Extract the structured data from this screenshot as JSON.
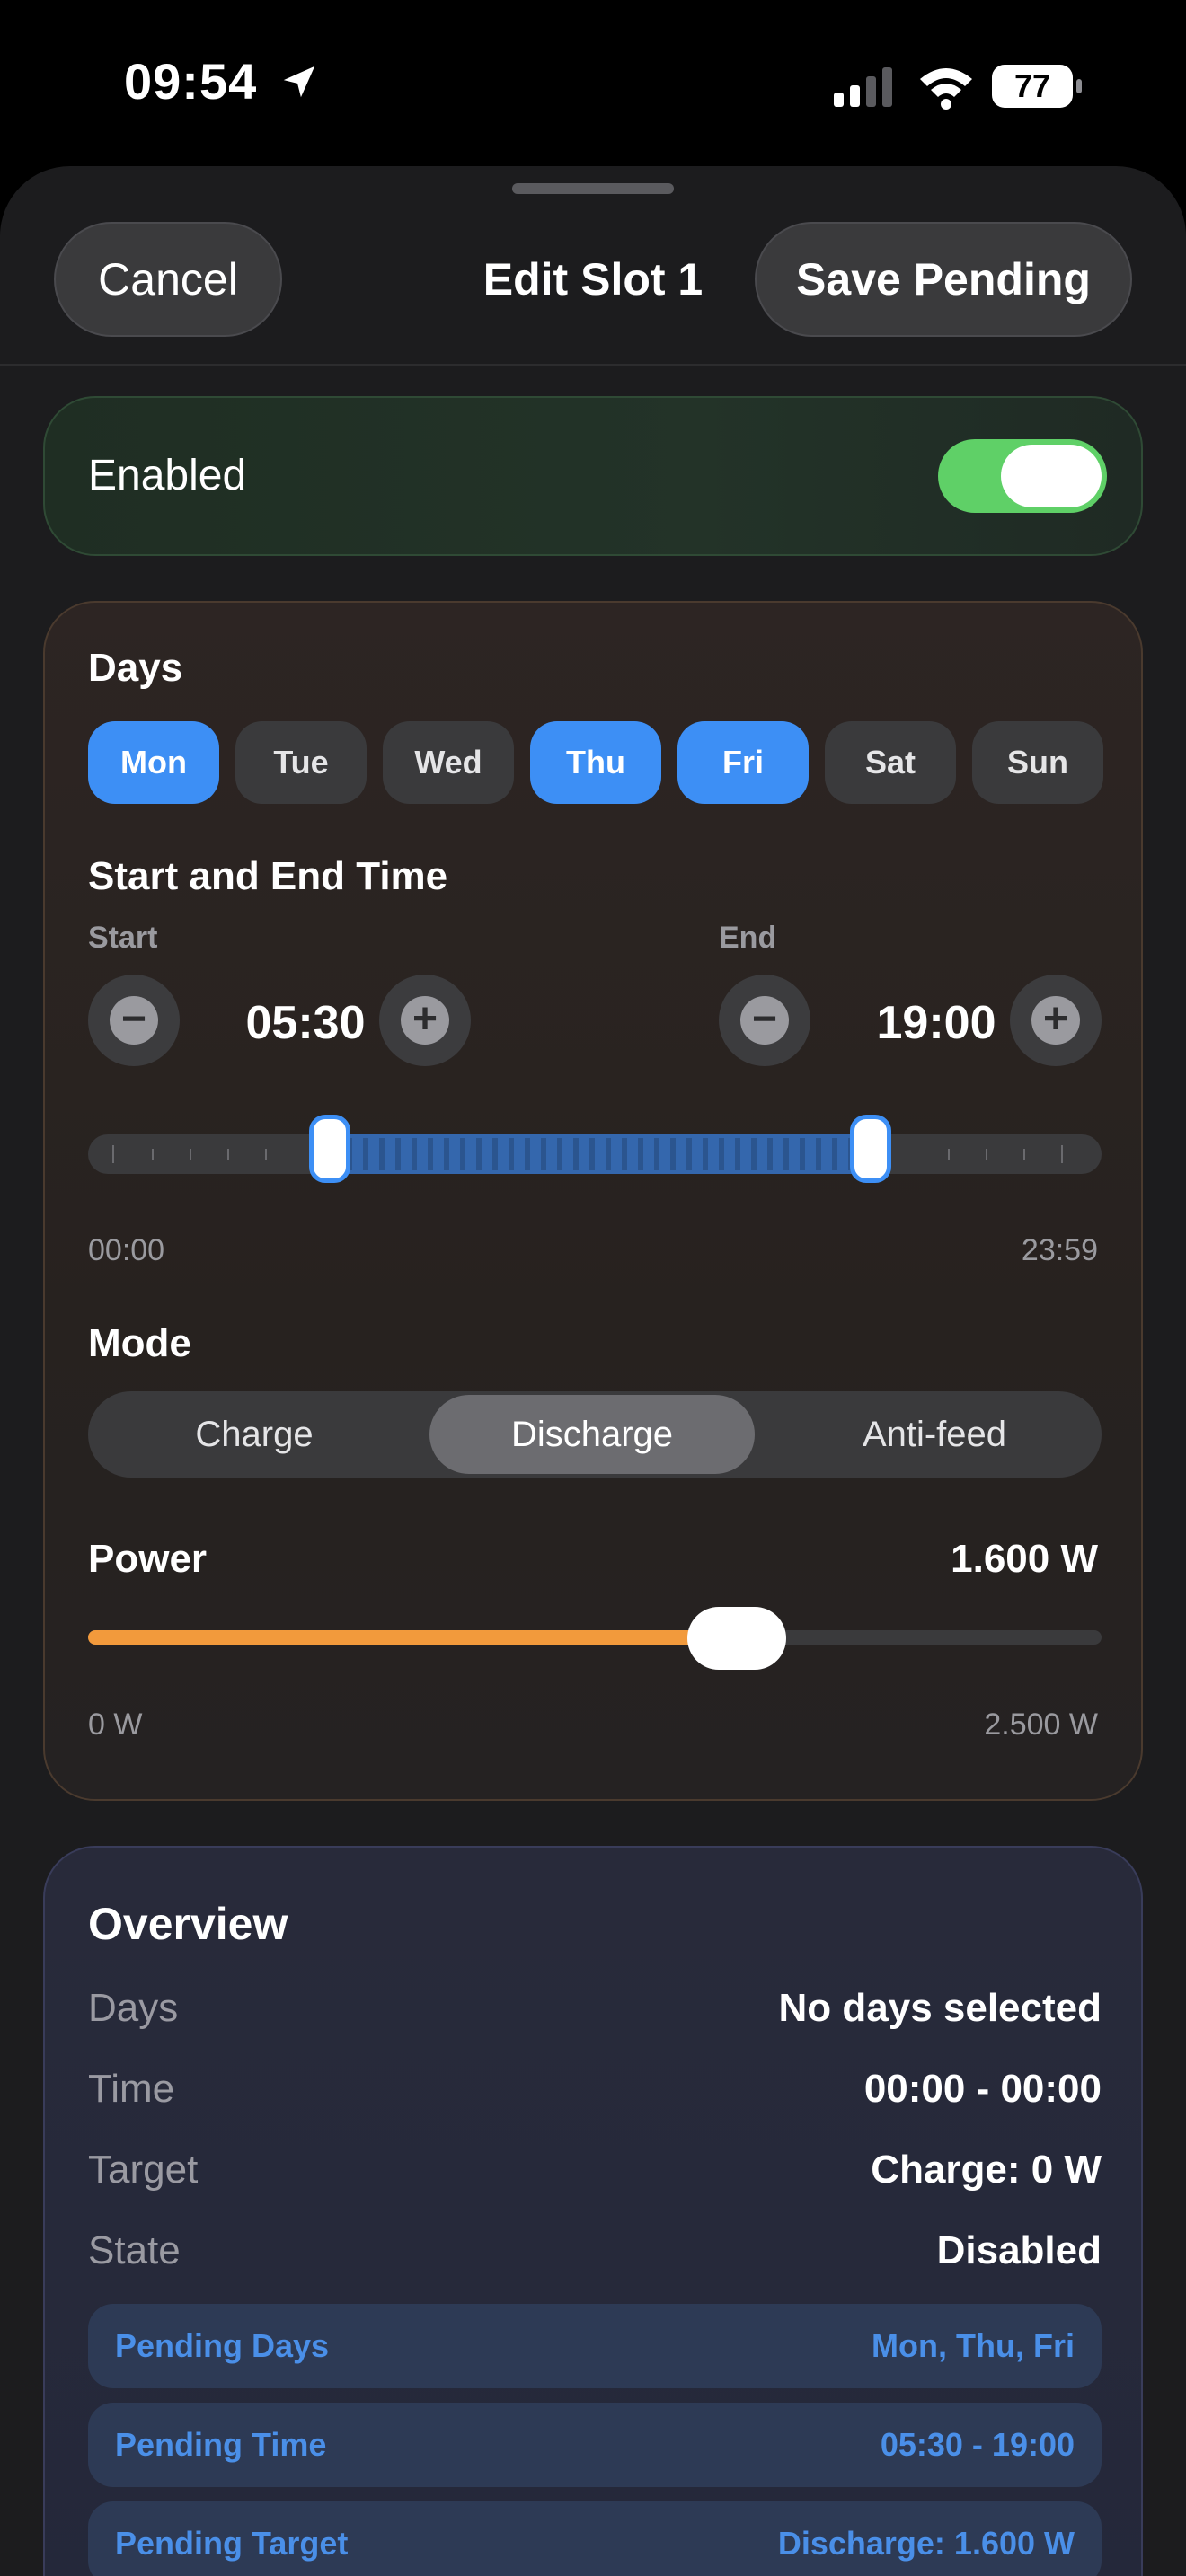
{
  "status_bar": {
    "time": "09:54",
    "battery": "77"
  },
  "header": {
    "cancel_label": "Cancel",
    "title": "Edit Slot 1",
    "save_label": "Save Pending"
  },
  "enabled": {
    "label": "Enabled",
    "value": true
  },
  "days": {
    "section_label": "Days",
    "items": [
      {
        "label": "Mon",
        "selected": true
      },
      {
        "label": "Tue",
        "selected": false
      },
      {
        "label": "Wed",
        "selected": false
      },
      {
        "label": "Thu",
        "selected": true
      },
      {
        "label": "Fri",
        "selected": true
      },
      {
        "label": "Sat",
        "selected": false
      },
      {
        "label": "Sun",
        "selected": false
      }
    ]
  },
  "time_range": {
    "section_label": "Start and End Time",
    "start_label": "Start",
    "start_value": "05:30",
    "end_label": "End",
    "end_value": "19:00",
    "min_label": "00:00",
    "max_label": "23:59"
  },
  "mode": {
    "section_label": "Mode",
    "options": [
      "Charge",
      "Discharge",
      "Anti-feed"
    ],
    "selected": "Discharge"
  },
  "power": {
    "section_label": "Power",
    "value_text": "1.600 W",
    "value": 1600,
    "max": 2500,
    "min_label": "0 W",
    "max_label": "2.500 W"
  },
  "overview": {
    "title": "Overview",
    "rows": [
      {
        "key": "Days",
        "value": "No days selected"
      },
      {
        "key": "Time",
        "value": "00:00 - 00:00"
      },
      {
        "key": "Target",
        "value": "Charge: 0 W"
      },
      {
        "key": "State",
        "value": "Disabled"
      }
    ],
    "pending": [
      {
        "key": "Pending Days",
        "value": "Mon, Thu, Fri"
      },
      {
        "key": "Pending Time",
        "value": "05:30 - 19:00"
      },
      {
        "key": "Pending Target",
        "value": "Discharge: 1.600 W"
      }
    ]
  },
  "colors": {
    "accent": "#3d8ff5",
    "toggle_on": "#5fd067",
    "power_fill": "#f29a3c",
    "pending_text": "#4a8fe8"
  }
}
